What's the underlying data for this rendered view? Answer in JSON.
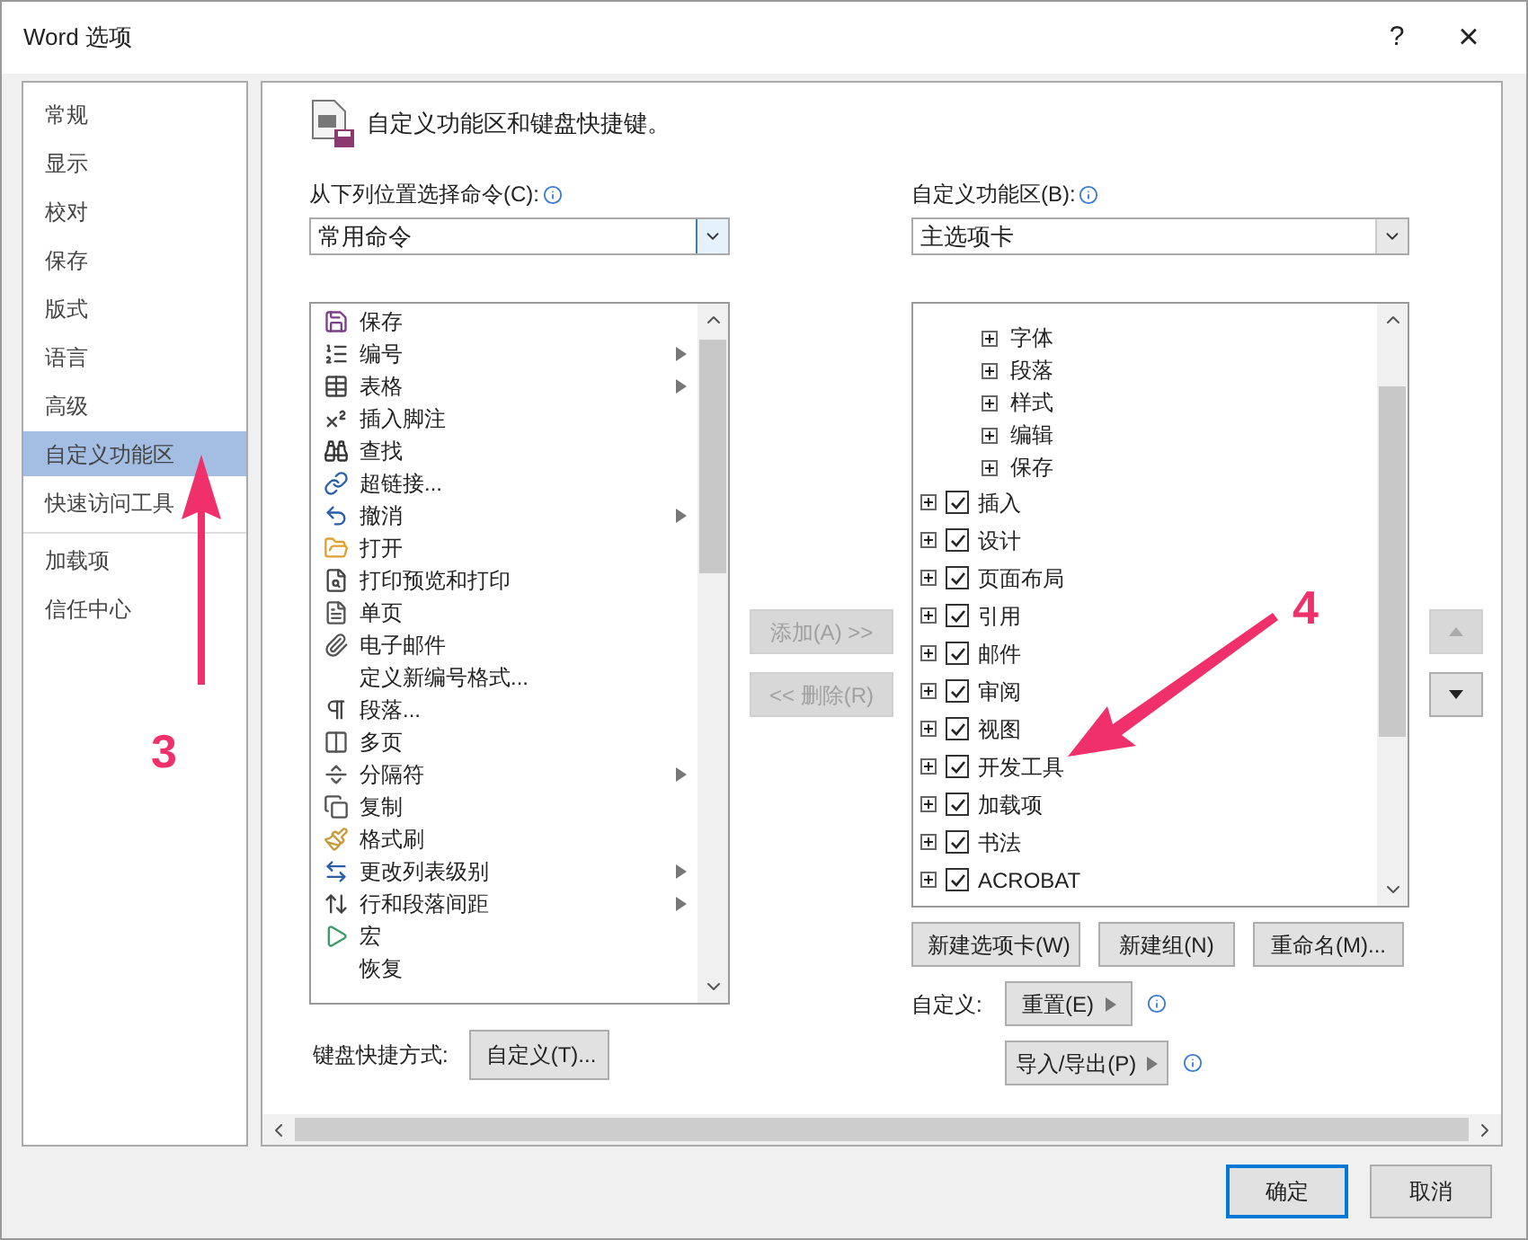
{
  "window": {
    "title": "Word 选项",
    "help": "?",
    "close": "×"
  },
  "nav": [
    {
      "label": "常规",
      "selected": false
    },
    {
      "label": "显示",
      "selected": false
    },
    {
      "label": "校对",
      "selected": false
    },
    {
      "label": "保存",
      "selected": false
    },
    {
      "label": "版式",
      "selected": false
    },
    {
      "label": "语言",
      "selected": false
    },
    {
      "label": "高级",
      "selected": false
    },
    {
      "label": "自定义功能区",
      "selected": true
    },
    {
      "label": "快速访问工具",
      "selected": false
    },
    {
      "label": "加载项",
      "selected": false
    },
    {
      "label": "信任中心",
      "selected": false
    }
  ],
  "header": "自定义功能区和键盘快捷键。",
  "commands": {
    "label": "从下列位置选择命令(C):",
    "value": "常用命令",
    "items": [
      {
        "label": "保存",
        "submenu": false
      },
      {
        "label": "编号",
        "submenu": true
      },
      {
        "label": "表格",
        "submenu": true
      },
      {
        "label": "插入脚注",
        "submenu": false
      },
      {
        "label": "查找",
        "submenu": false
      },
      {
        "label": "超链接...",
        "submenu": false
      },
      {
        "label": "撤消",
        "submenu": true
      },
      {
        "label": "打开",
        "submenu": false
      },
      {
        "label": "打印预览和打印",
        "submenu": false
      },
      {
        "label": "单页",
        "submenu": false
      },
      {
        "label": "电子邮件",
        "submenu": false
      },
      {
        "label": "定义新编号格式...",
        "submenu": false
      },
      {
        "label": "段落...",
        "submenu": false
      },
      {
        "label": "多页",
        "submenu": false
      },
      {
        "label": "分隔符",
        "submenu": true
      },
      {
        "label": "复制",
        "submenu": false
      },
      {
        "label": "格式刷",
        "submenu": false
      },
      {
        "label": "更改列表级别",
        "submenu": true
      },
      {
        "label": "行和段落间距",
        "submenu": true
      },
      {
        "label": "宏",
        "submenu": false
      },
      {
        "label": "恢复",
        "submenu": false
      }
    ]
  },
  "add_button": {
    "label": "添加(A) >>",
    "disabled": true
  },
  "remove_button": {
    "label": "<< 删除(R)",
    "disabled": true
  },
  "shortcuts": {
    "label": "键盘快捷方式:",
    "button": "自定义(T)..."
  },
  "ribbon": {
    "label": "自定义功能区(B):",
    "value": "主选项卡",
    "tree": [
      {
        "children": [
          {
            "label": "字体",
            "expanded": false
          },
          {
            "label": "段落",
            "expanded": false
          },
          {
            "label": "样式",
            "expanded": false
          },
          {
            "label": "编辑",
            "expanded": false
          },
          {
            "label": "保存",
            "expanded": false
          }
        ]
      },
      {
        "label": "插入",
        "expanded": false,
        "checked": true
      },
      {
        "label": "设计",
        "expanded": false,
        "checked": true
      },
      {
        "label": "页面布局",
        "expanded": false,
        "checked": true
      },
      {
        "label": "引用",
        "expanded": false,
        "checked": true
      },
      {
        "label": "邮件",
        "expanded": false,
        "checked": true
      },
      {
        "label": "审阅",
        "expanded": false,
        "checked": true
      },
      {
        "label": "视图",
        "expanded": false,
        "checked": true
      },
      {
        "label": "开发工具",
        "expanded": false,
        "checked": true
      },
      {
        "label": "加载项",
        "expanded": false,
        "checked": true
      },
      {
        "label": "书法",
        "expanded": false,
        "checked": true
      },
      {
        "label": "ACROBAT",
        "expanded": false,
        "checked": true
      }
    ],
    "buttons": [
      "新建选项卡(W)",
      "新建组(N)",
      "重命名(M)..."
    ],
    "customize_label": "自定义:",
    "reset": "重置(E)",
    "import_export": "导入/导出(P)"
  },
  "footer": {
    "ok": "确定",
    "cancel": "取消"
  },
  "annotations": [
    {
      "label": "3"
    },
    {
      "label": "4"
    }
  ]
}
